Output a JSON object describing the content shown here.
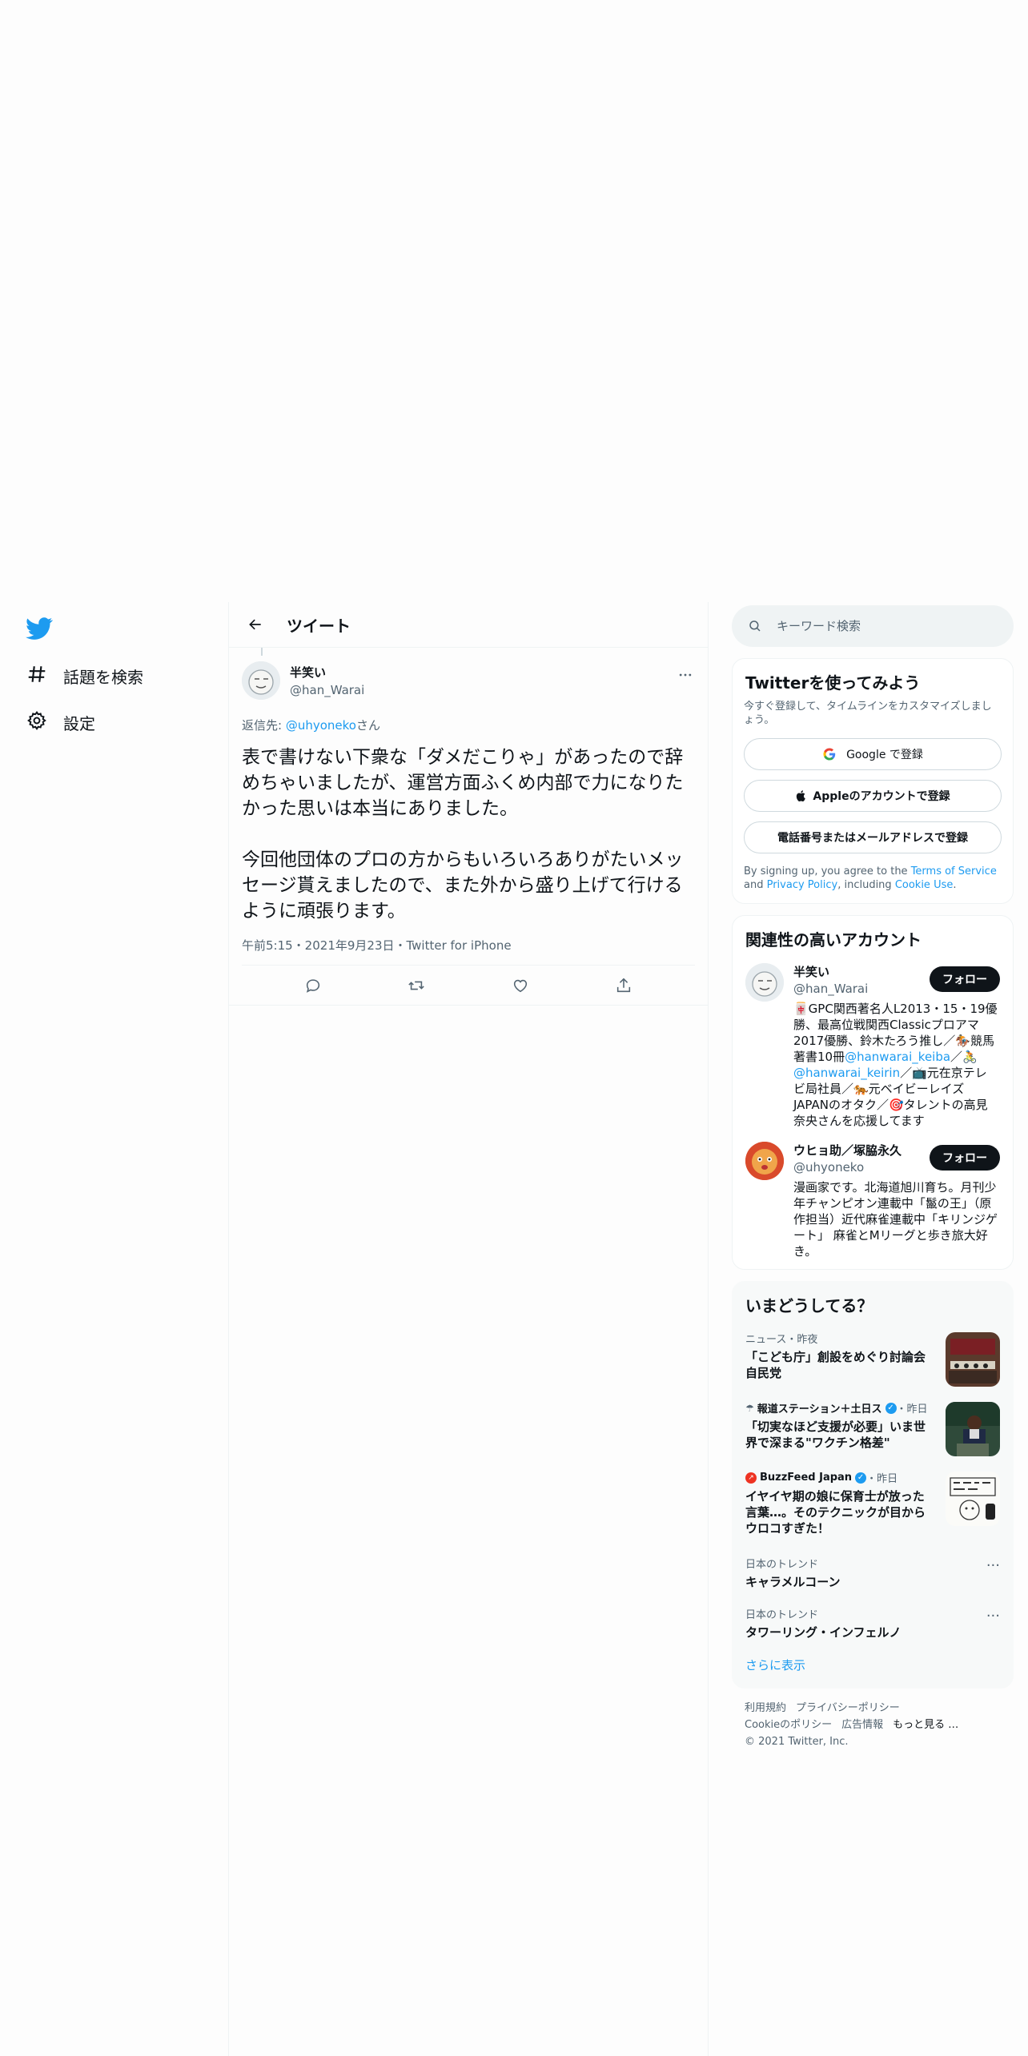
{
  "nav": {
    "explore_label": "話題を検索",
    "settings_label": "設定"
  },
  "header": {
    "title": "ツイート"
  },
  "tweet": {
    "display_name": "半笑い",
    "handle": "@han_Warai",
    "reply_prefix": "返信先: ",
    "reply_mention": "@uhyoneko",
    "reply_suffix": "さん",
    "text": "表で書けない下衆な「ダメだこりゃ」があったので辞めちゃいましたが、運営方面ふくめ内部で力になりたかった思いは本当にありました。\n\n今回他団体のプロの方からもいろいろありがたいメッセージ貰えましたので、また外から盛り上げて行けるように頑張ります。",
    "meta": "午前5:15・2021年9月23日・Twitter for iPhone"
  },
  "search": {
    "placeholder": "キーワード検索"
  },
  "signup": {
    "title": "Twitterを使ってみよう",
    "subtitle": "今すぐ登録して、タイムラインをカスタマイズしましょう。",
    "google_label": "Google で登録",
    "apple_label": "Appleのアカウントで登録",
    "phone_label": "電話番号またはメールアドレスで登録",
    "terms_prefix": "By signing up, you agree to the ",
    "terms_link": "Terms of Service",
    "terms_and": " and ",
    "privacy_link": "Privacy Policy",
    "terms_including": ", including ",
    "cookie_link": "Cookie Use",
    "terms_end": "."
  },
  "related": {
    "title": "関連性の高いアカウント",
    "follow_label": "フォロー",
    "accounts": [
      {
        "name": "半笑い",
        "handle": "@han_Warai",
        "bio_1": "🀄GPC関西著名人L2013・15・19優勝、最高位戦関西Classicプロアマ2017優勝、鈴木たろう推し／🏇競馬著書10冊",
        "bio_link_1": "@hanwarai_keiba",
        "bio_2": "／🚴",
        "bio_link_2": "@hanwarai_keirin",
        "bio_3": "／📺元在京テレビ局社員／🐅元ベイビーレイズJAPANのオタク／🎯タレントの高見奈央さんを応援してます"
      },
      {
        "name": "ウヒョ助／塚脇永久",
        "handle": "@uhyoneko",
        "bio_1": "漫画家です。北海道旭川育ち。月刊少年チャンピオン連載中「鬣の王」（原作担当）近代麻雀連載中「キリンジゲート」 麻雀とMリーグと歩き旅大好き。"
      }
    ]
  },
  "trends": {
    "title": "いまどうしてる？",
    "items": [
      {
        "meta": "ニュース・昨夜",
        "title": "「こども庁」創設をめぐり討論会 自民党"
      },
      {
        "source": "報道ステーション＋土日ス",
        "time": "・昨日",
        "title": "「切実なほど支援が必要」いま世界で深まる\"ワクチン格差\""
      },
      {
        "source": "BuzzFeed Japan",
        "time": "・昨日",
        "title": "イヤイヤ期の娘に保育士が放った言葉…。そのテクニックが目からウロコすぎた！"
      },
      {
        "meta": "日本のトレンド",
        "title": "キャラメルコーン"
      },
      {
        "meta": "日本のトレンド",
        "title": "タワーリング・インフェルノ"
      }
    ],
    "show_more": "さらに表示"
  },
  "footer": {
    "terms": "利用規約",
    "privacy": "プライバシーポリシー",
    "cookies": "Cookieのポリシー",
    "ads": "広告情報",
    "more": "もっと見る …",
    "copyright": "© 2021 Twitter, Inc."
  },
  "colors": {
    "accent": "#1d9bf0",
    "text": "#0f1419",
    "muted": "#536471",
    "border": "#eff3f4"
  }
}
